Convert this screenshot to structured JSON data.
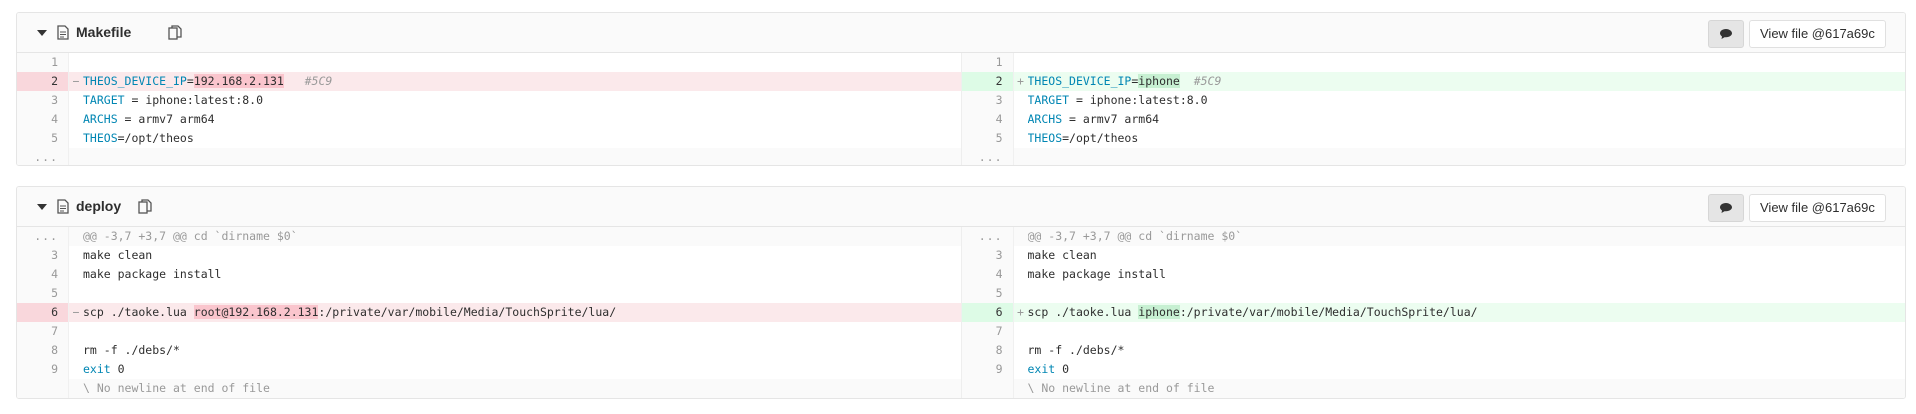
{
  "files": [
    {
      "name": "Makefile",
      "view_file_label": "View file @617a69c",
      "left": [
        {
          "num": "1",
          "type": "ctx",
          "marker": "",
          "segments": []
        },
        {
          "num": "2",
          "type": "old",
          "marker": "−",
          "segments": [
            {
              "t": "THEOS_DEVICE_IP",
              "c": "k"
            },
            {
              "t": "="
            },
            {
              "t": "192.168.2.131",
              "c": "hl-old"
            },
            {
              "t": "   "
            },
            {
              "t": "#5C9",
              "c": "cm"
            }
          ]
        },
        {
          "num": "3",
          "type": "ctx",
          "marker": "",
          "segments": [
            {
              "t": "TARGET",
              "c": "k"
            },
            {
              "t": " = iphone:latest:8.0"
            }
          ]
        },
        {
          "num": "4",
          "type": "ctx",
          "marker": "",
          "segments": [
            {
              "t": "ARCHS",
              "c": "k"
            },
            {
              "t": " = armv7 arm64"
            }
          ]
        },
        {
          "num": "5",
          "type": "ctx",
          "marker": "",
          "segments": [
            {
              "t": "THEOS",
              "c": "k"
            },
            {
              "t": "=/opt/theos"
            }
          ]
        },
        {
          "num": "...",
          "type": "dots",
          "marker": "",
          "segments": []
        }
      ],
      "right": [
        {
          "num": "1",
          "type": "ctx",
          "marker": "",
          "segments": []
        },
        {
          "num": "2",
          "type": "new",
          "marker": "+",
          "segments": [
            {
              "t": "THEOS_DEVICE_IP",
              "c": "k"
            },
            {
              "t": "="
            },
            {
              "t": "iphone",
              "c": "hl-new"
            },
            {
              "t": "  "
            },
            {
              "t": "#5C9",
              "c": "cm"
            }
          ]
        },
        {
          "num": "3",
          "type": "ctx",
          "marker": "",
          "segments": [
            {
              "t": "TARGET",
              "c": "k"
            },
            {
              "t": " = iphone:latest:8.0"
            }
          ]
        },
        {
          "num": "4",
          "type": "ctx",
          "marker": "",
          "segments": [
            {
              "t": "ARCHS",
              "c": "k"
            },
            {
              "t": " = armv7 arm64"
            }
          ]
        },
        {
          "num": "5",
          "type": "ctx",
          "marker": "",
          "segments": [
            {
              "t": "THEOS",
              "c": "k"
            },
            {
              "t": "=/opt/theos"
            }
          ]
        },
        {
          "num": "...",
          "type": "dots",
          "marker": "",
          "segments": []
        }
      ]
    },
    {
      "name": "deploy",
      "view_file_label": "View file @617a69c",
      "left": [
        {
          "num": "...",
          "type": "match",
          "marker": "",
          "segments": [
            {
              "t": "@@ -3,7 +3,7 @@ cd `dirname $0`"
            }
          ]
        },
        {
          "num": "3",
          "type": "ctx",
          "marker": "",
          "segments": [
            {
              "t": "make clean"
            }
          ]
        },
        {
          "num": "4",
          "type": "ctx",
          "marker": "",
          "segments": [
            {
              "t": "make package install"
            }
          ]
        },
        {
          "num": "5",
          "type": "ctx",
          "marker": "",
          "segments": []
        },
        {
          "num": "6",
          "type": "old",
          "marker": "−",
          "segments": [
            {
              "t": "scp ./taoke.lua "
            },
            {
              "t": "root@192.168.2.131",
              "c": "hl-old"
            },
            {
              "t": ":/private/var/mobile/Media/TouchSprite/lua/"
            }
          ]
        },
        {
          "num": "7",
          "type": "ctx",
          "marker": "",
          "segments": []
        },
        {
          "num": "8",
          "type": "ctx",
          "marker": "",
          "segments": [
            {
              "t": "rm -f ./debs/*"
            }
          ]
        },
        {
          "num": "9",
          "type": "ctx",
          "marker": "",
          "segments": [
            {
              "t": "exit",
              "c": "k"
            },
            {
              "t": " 0"
            }
          ]
        },
        {
          "num": "",
          "type": "meta",
          "marker": "",
          "segments": [
            {
              "t": "\\ No newline at end of file"
            }
          ]
        }
      ],
      "right": [
        {
          "num": "...",
          "type": "match",
          "marker": "",
          "segments": [
            {
              "t": "@@ -3,7 +3,7 @@ cd `dirname $0`"
            }
          ]
        },
        {
          "num": "3",
          "type": "ctx",
          "marker": "",
          "segments": [
            {
              "t": "make clean"
            }
          ]
        },
        {
          "num": "4",
          "type": "ctx",
          "marker": "",
          "segments": [
            {
              "t": "make package install"
            }
          ]
        },
        {
          "num": "5",
          "type": "ctx",
          "marker": "",
          "segments": []
        },
        {
          "num": "6",
          "type": "new",
          "marker": "+",
          "segments": [
            {
              "t": "scp ./taoke.lua "
            },
            {
              "t": "iphone",
              "c": "hl-new"
            },
            {
              "t": ":/private/var/mobile/Media/TouchSprite/lua/"
            }
          ]
        },
        {
          "num": "7",
          "type": "ctx",
          "marker": "",
          "segments": []
        },
        {
          "num": "8",
          "type": "ctx",
          "marker": "",
          "segments": [
            {
              "t": "rm -f ./debs/*"
            }
          ]
        },
        {
          "num": "9",
          "type": "ctx",
          "marker": "",
          "segments": [
            {
              "t": "exit",
              "c": "k"
            },
            {
              "t": " 0"
            }
          ]
        },
        {
          "num": "",
          "type": "meta",
          "marker": "",
          "segments": [
            {
              "t": "\\ No newline at end of file"
            }
          ]
        }
      ]
    }
  ]
}
